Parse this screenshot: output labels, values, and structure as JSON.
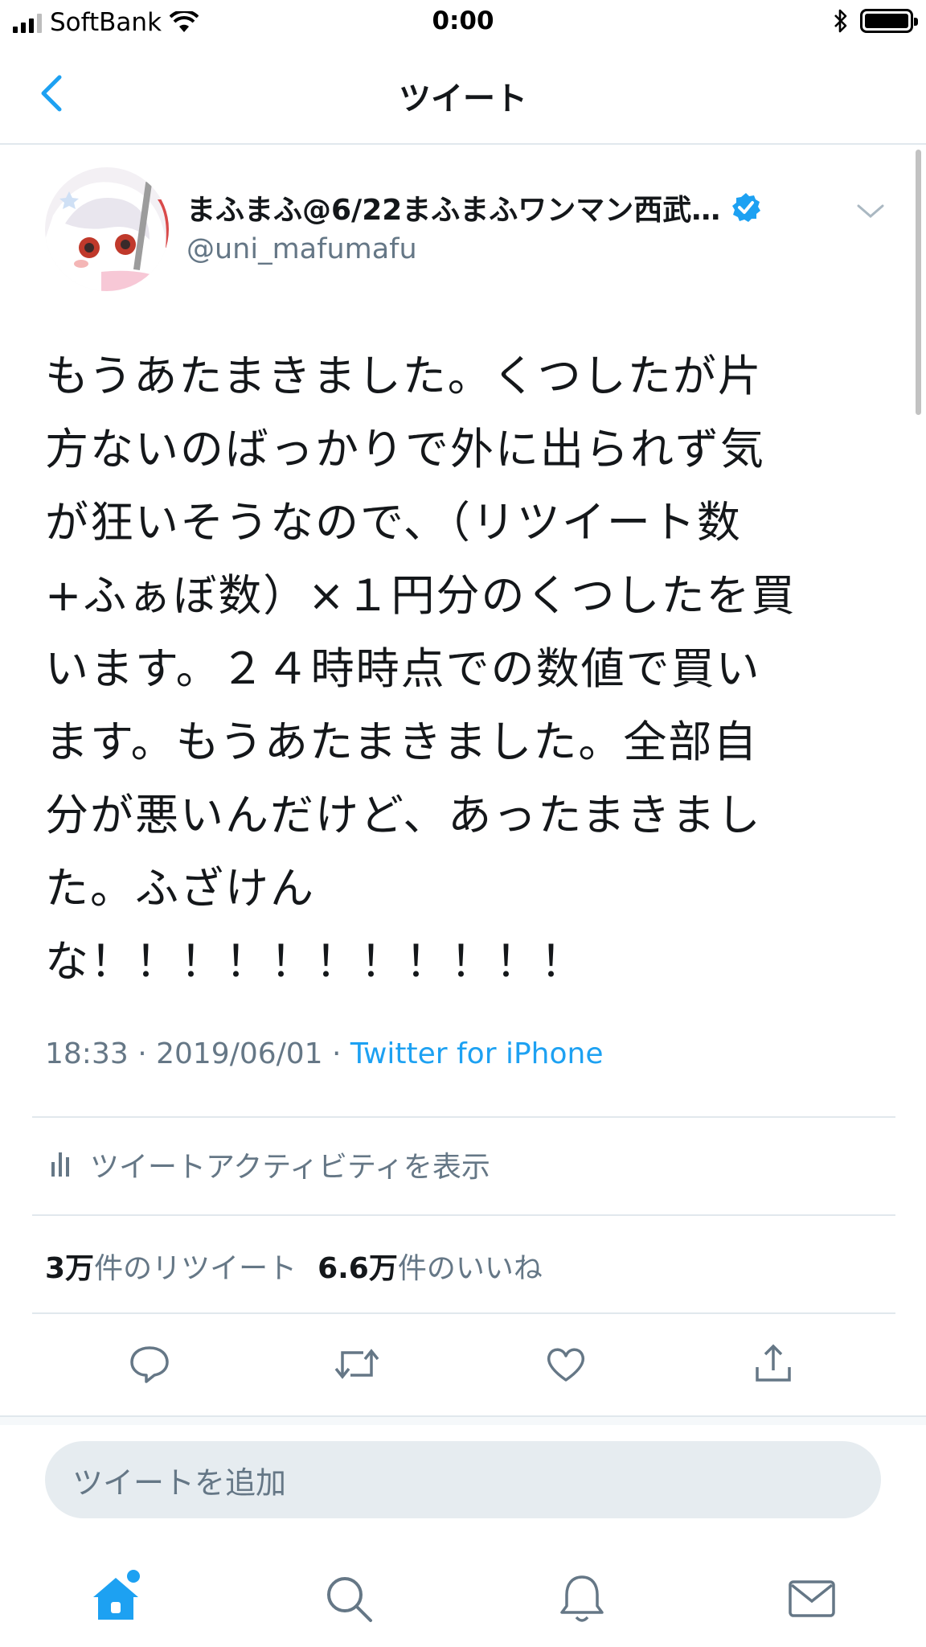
{
  "status_bar": {
    "carrier": "SoftBank",
    "time": "0:00"
  },
  "nav": {
    "title": "ツイート"
  },
  "tweet": {
    "author_name": "まふまふ@6/22まふまふワンマン西武…",
    "handle": "@uni_mafumafu",
    "text": "もうあたまきました。くつしたが片\n方ないのばっかりで外に出られず気\nが狂いそうなので、（リツイート数\n+ふぁぼ数）×１円分のくつしたを買\nいます。２４時時点での数値で買い\nます。もうあたまきました。全部自\n分が悪いんだけど、あったまきまし\nた。ふざけん\nな！！！！！！！！！！！",
    "timestamp": "18:33 · 2019/06/01 · ",
    "source": "Twitter for iPhone",
    "activity_label": "ツイートアクティビティを表示",
    "retweet_count": "3万",
    "retweet_label": "件のリツイート",
    "like_count": "6.6万",
    "like_label": "件のいいね"
  },
  "reply": {
    "placeholder": "ツイートを追加"
  },
  "icons": [
    "back-chevron-icon",
    "verified-badge-icon",
    "chevron-down-icon",
    "activity-bars-icon",
    "reply-icon",
    "retweet-icon",
    "like-icon",
    "share-icon",
    "home-icon",
    "search-icon",
    "notifications-icon",
    "messages-icon",
    "bluetooth-icon",
    "battery-icon",
    "signal-icon",
    "wifi-icon"
  ],
  "colors": {
    "accent": "#1da1f2",
    "muted": "#657786",
    "text": "#14171a"
  }
}
